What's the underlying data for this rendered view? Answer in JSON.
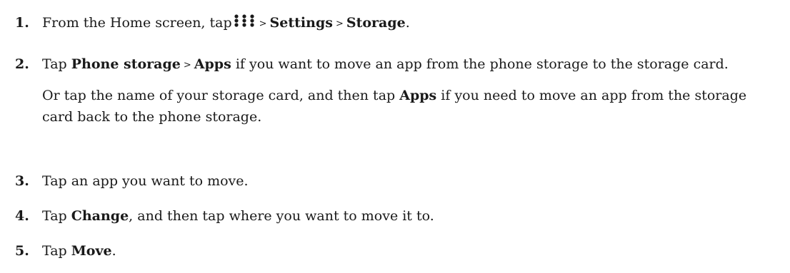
{
  "steps": [
    {
      "number": "1.",
      "segments": {
        "t1": "From the Home screen, tap",
        "icon": "apps-grid-icon",
        "sep1": ">",
        "settings": "Settings",
        "sep2": ">",
        "storage": "Storage",
        "end": "."
      }
    },
    {
      "number": "2.",
      "p1": {
        "t1": "Tap ",
        "phone_storage": "Phone storage",
        "sep": ">",
        "apps": "Apps",
        "t2": " if you want to move an app from the phone storage to the storage card."
      },
      "p2": {
        "t1": "Or tap the name of your storage card, and then tap ",
        "apps": "Apps",
        "t2": " if you need to move an app from the storage card back to the phone storage."
      }
    },
    {
      "number": "3.",
      "text": "Tap an app you want to move."
    },
    {
      "number": "4.",
      "t1": "Tap ",
      "change": "Change",
      "t2": ", and then tap where you want to move it to."
    },
    {
      "number": "5.",
      "t1": "Tap ",
      "move": "Move",
      "t2": "."
    }
  ]
}
